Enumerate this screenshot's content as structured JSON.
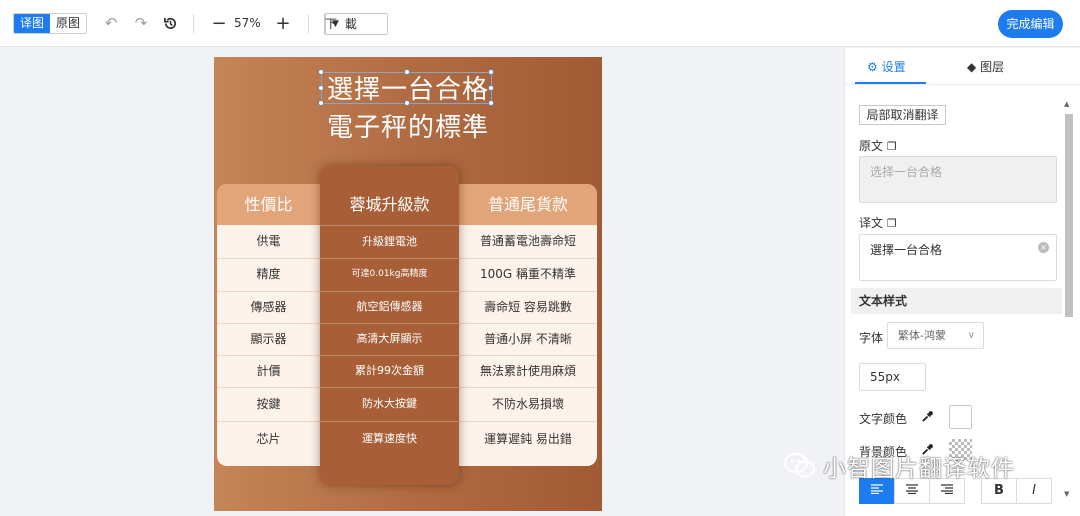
{
  "toolbar": {
    "tab_translated": "译图",
    "tab_original": "原图",
    "zoom_level": "57%",
    "download_label": "下 載",
    "finish_label": "完成编辑"
  },
  "poster": {
    "title_line1": "選擇一台合格",
    "title_line2": "電子秤的標準",
    "headers": [
      "性價比",
      "蓉城升級款",
      "普通尾貨款"
    ],
    "rows": [
      {
        "label": "供電",
        "upgrade": "升級鋰電池",
        "normal": "普通蓄電池壽命短"
      },
      {
        "label": "精度",
        "upgrade": "可達0.01kg高精度",
        "normal": "100G 稱重不精準"
      },
      {
        "label": "傳感器",
        "upgrade": "航空鋁傳感器",
        "normal": "壽命短 容易跳數"
      },
      {
        "label": "顯示器",
        "upgrade": "高清大屏顯示",
        "normal": "普通小屏 不清晰"
      },
      {
        "label": "計價",
        "upgrade": "累計99次金額",
        "normal": "無法累計使用麻煩"
      },
      {
        "label": "按鍵",
        "upgrade": "防水大按鍵",
        "normal": "不防水易損壞"
      },
      {
        "label": "芯片",
        "upgrade": "運算速度快",
        "normal": "運算遲鈍 易出錯"
      }
    ]
  },
  "panel": {
    "tab_settings": "设置",
    "tab_layers": "图层",
    "partial_cancel_label": "局部取消翻译",
    "original_label": "原文",
    "original_text": "选择一台合格",
    "translation_label": "译文",
    "translation_text": "選擇一台合格",
    "text_style_label": "文本样式",
    "font_label": "字体",
    "font_value": "繁体-鸿蒙",
    "font_size": "55px",
    "text_color_label": "文字颜色",
    "bg_color_label": "背景颜色",
    "bold_label": "B",
    "italic_label": "I"
  },
  "watermark": {
    "text": "小智图片翻译软件"
  },
  "colors": {
    "accent": "#1e7cf0",
    "poster_bg": "#b26c43",
    "header_bg": "#e2a57a",
    "middle_column": "#a85f38"
  }
}
